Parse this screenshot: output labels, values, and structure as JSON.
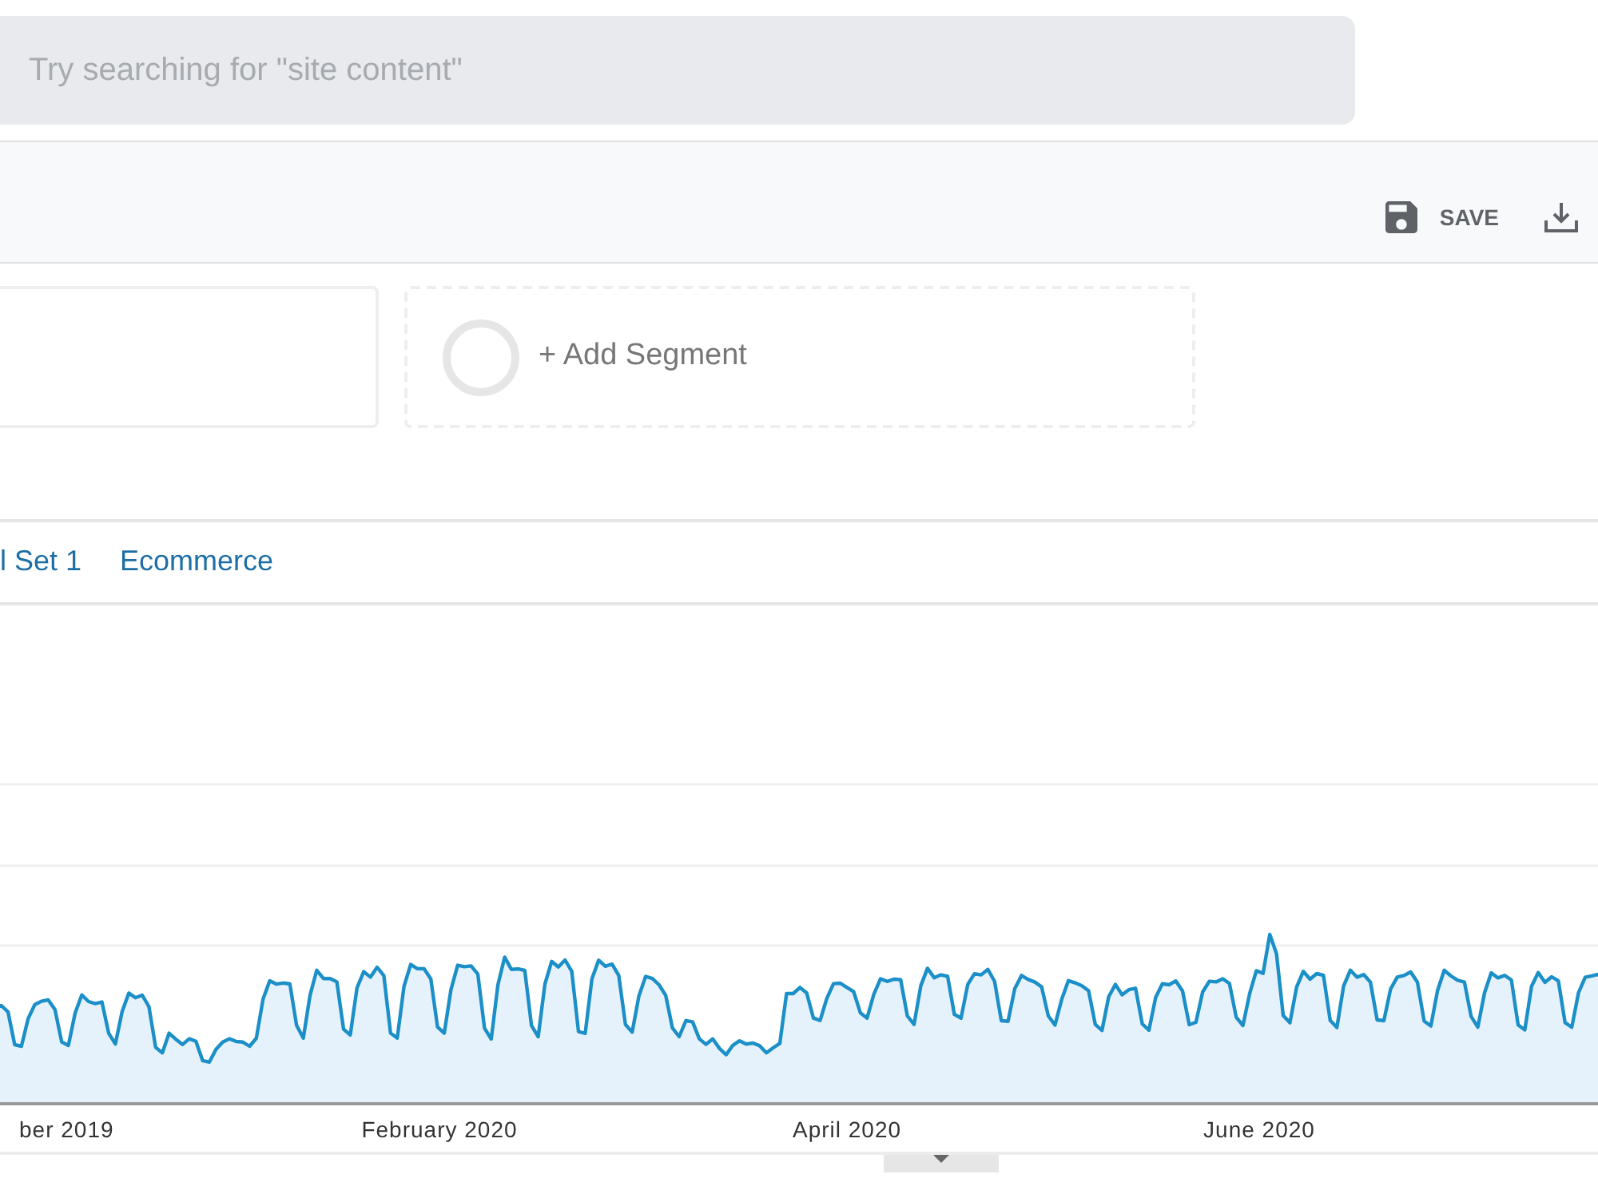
{
  "search": {
    "placeholder": "Try searching for \"site content\""
  },
  "toolbar": {
    "buttons": [
      {
        "kind": "save",
        "label": "SAVE"
      },
      {
        "kind": "download"
      }
    ]
  },
  "segments": {
    "add_label": "+ Add Segment"
  },
  "tabs": [
    {
      "label": "l Set 1",
      "selected": false
    },
    {
      "label": "Ecommerce",
      "selected": false
    }
  ],
  "chart": {
    "x_labels": [
      "ber 2019",
      "February 2020",
      "April 2020",
      "June 2020"
    ]
  }
}
